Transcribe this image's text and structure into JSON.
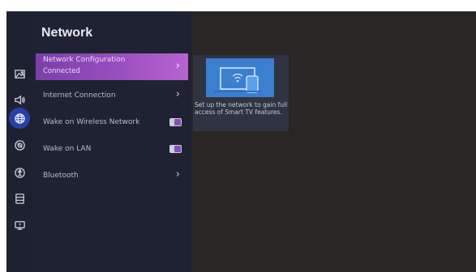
{
  "menu": {
    "title": "Network",
    "items": [
      {
        "label": "Network Configuration",
        "sub": "Connected",
        "type": "submenu",
        "selected": true
      },
      {
        "label": "Internet Connection",
        "type": "submenu"
      },
      {
        "label": "Wake on Wireless Network",
        "type": "toggle",
        "checked": true
      },
      {
        "label": "Wake on LAN",
        "type": "toggle",
        "checked": true
      },
      {
        "label": "Bluetooth",
        "type": "submenu"
      }
    ]
  },
  "rail": {
    "icons": [
      "picture-icon",
      "sound-icon",
      "network-icon",
      "general-icon",
      "accessibility-icon",
      "support-icon",
      "device-icon"
    ],
    "active": "network-icon"
  },
  "info": {
    "text": "Set up the network to gain full access of Smart TV features."
  },
  "colors": {
    "selected_gradient_start": "#7b3fa8",
    "selected_gradient_end": "#b764d0",
    "panel_bg": "#1f2233",
    "screen_bg": "#2a2626",
    "active_icon_bg": "#2b3fa8"
  }
}
